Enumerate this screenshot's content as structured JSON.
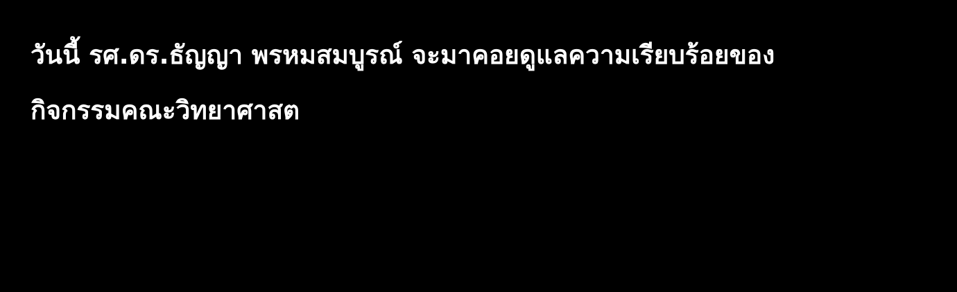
{
  "caption": {
    "lines": [
      "วันนี้ รศ.ดร.ธัญญา พรหมสมบูรณ์ จะมาคอยดูแลความเรียบร้อยของ",
      "กิจกรรมคณะวิทยาศาสต"
    ]
  },
  "colors": {
    "background": "#000000",
    "text": "#ffffff"
  }
}
